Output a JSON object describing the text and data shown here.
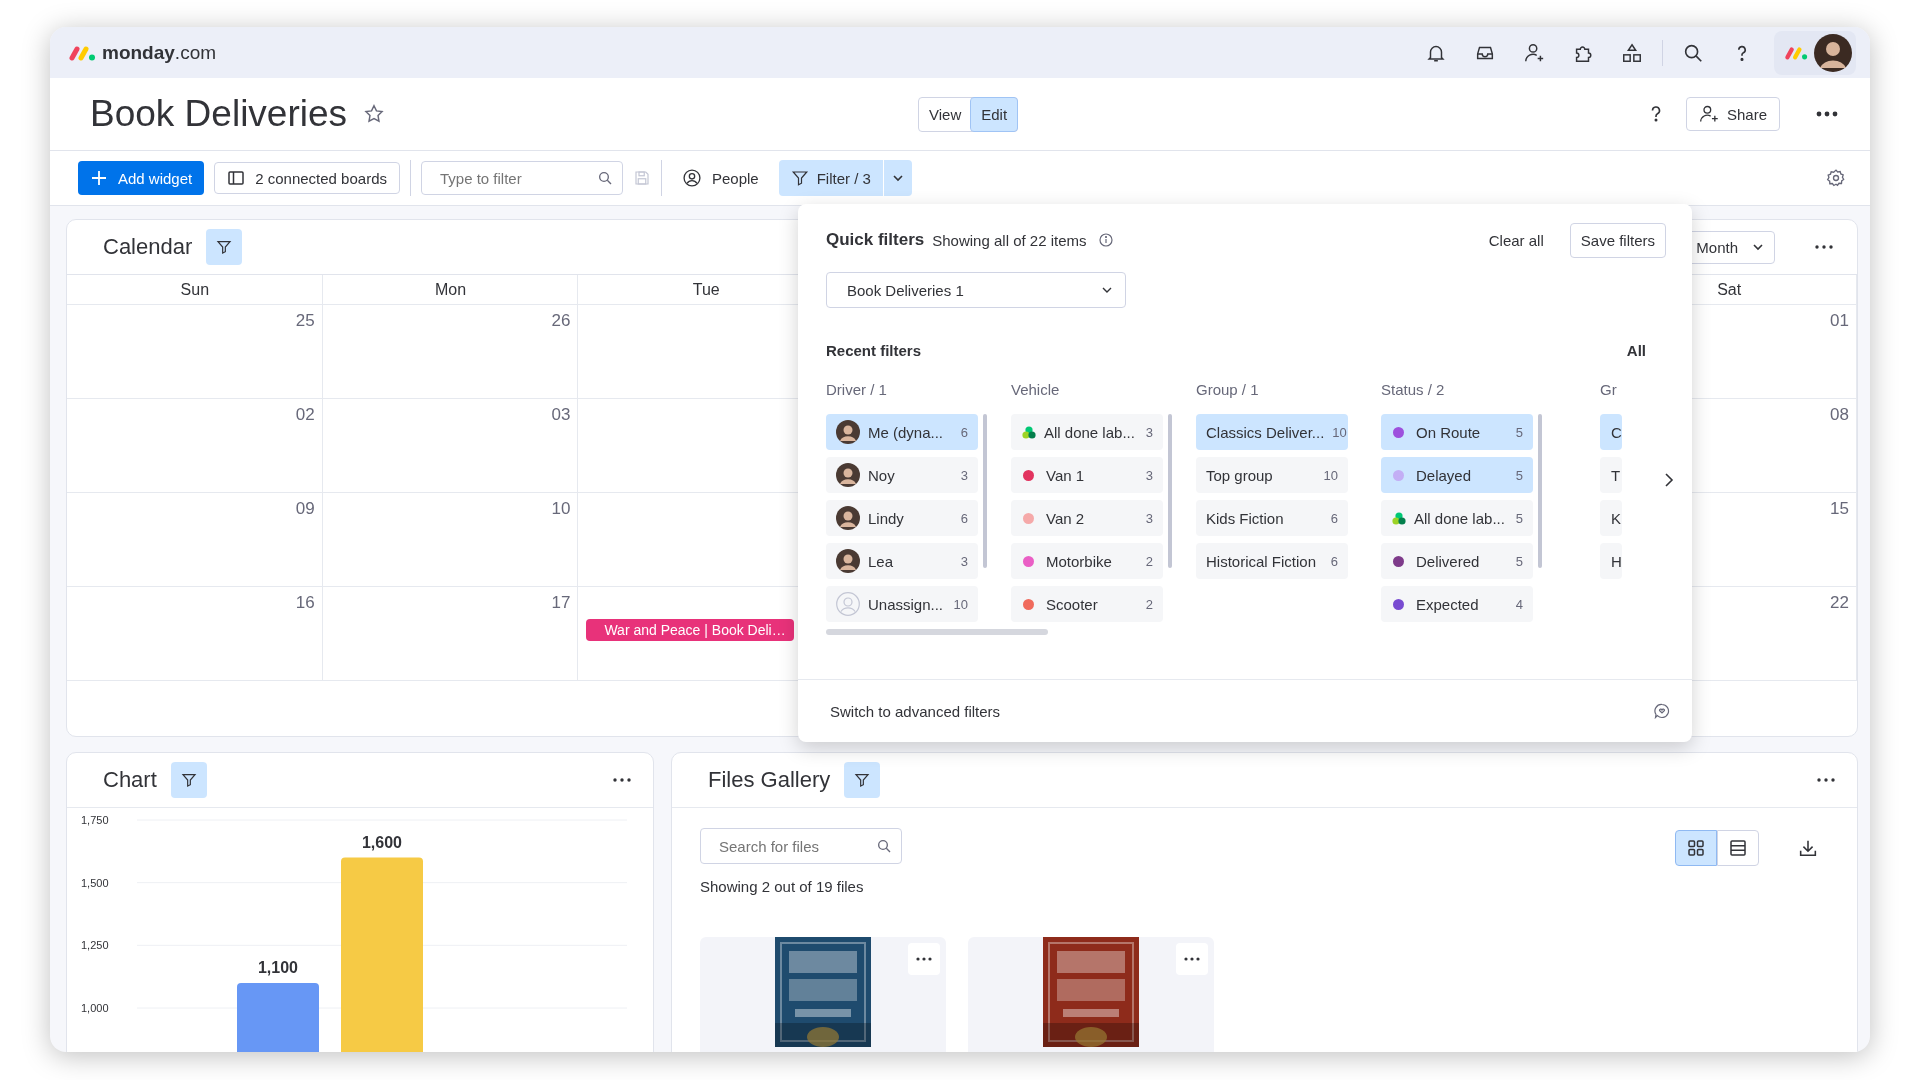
{
  "app": {
    "logo_text": "monday",
    "logo_suffix": ".com"
  },
  "header": {
    "title": "Book Deliveries",
    "starred": false,
    "view_modes": [
      {
        "label": "View",
        "selected": false
      },
      {
        "label": "Edit",
        "selected": true
      }
    ],
    "share": "Share"
  },
  "toolbar": {
    "add_widget": "Add widget",
    "connected_boards": "2 connected boards",
    "filter_placeholder": "Type to filter",
    "people": "People",
    "filter": "Filter / 3",
    "filter_active": true
  },
  "calendar": {
    "title": "Calendar",
    "filter_active": true,
    "view": "Month",
    "days": [
      {
        "label": "Sun",
        "cells": [
          {
            "date": "25"
          },
          {
            "date": "02"
          },
          {
            "date": "09"
          },
          {
            "date": "16"
          }
        ]
      },
      {
        "label": "Mon",
        "cells": [
          {
            "date": "26"
          },
          {
            "date": "03"
          },
          {
            "date": "10"
          },
          {
            "date": "17"
          }
        ]
      },
      {
        "label": "Tue",
        "cells": [
          {},
          {},
          {},
          {
            "event": {
              "title": "War and Peace | Book Deli…",
              "color": "#e8327a"
            }
          }
        ]
      },
      {
        "label": "Sat",
        "cells": [
          {
            "date": "01"
          },
          {
            "date": "08"
          },
          {
            "date": "15"
          },
          {
            "date": "22"
          }
        ]
      }
    ]
  },
  "quick_filters": {
    "title": "Quick filters",
    "summary": "Showing all of 22 items",
    "clear": "Clear all",
    "save": "Save filters",
    "board": "Book Deliveries 1",
    "recent_heading": "Recent filters",
    "all_heading": "All",
    "advanced": "Switch to advanced filters",
    "columns": [
      {
        "kind": "full",
        "heading": "Driver / 1",
        "items": [
          {
            "kind": "avatar",
            "label": "Me (dyna...",
            "count": "6",
            "selected": true
          },
          {
            "kind": "avatar",
            "label": "Noy",
            "count": "3",
            "selected": false
          },
          {
            "kind": "avatar",
            "label": "Lindy",
            "count": "6",
            "selected": false
          },
          {
            "kind": "avatar",
            "label": "Lea",
            "count": "3",
            "selected": false
          },
          {
            "kind": "empty-avatar",
            "label": "Unassign...",
            "count": "10",
            "selected": false
          }
        ]
      },
      {
        "kind": "full",
        "heading": "Vehicle",
        "items": [
          {
            "kind": "cluster",
            "label": "All done lab...",
            "count": "3",
            "selected": false
          },
          {
            "kind": "dot",
            "color": "#e2345f",
            "label": "Van 1",
            "count": "3",
            "selected": false
          },
          {
            "kind": "dot",
            "color": "#f5a9a9",
            "label": "Van 2",
            "count": "3",
            "selected": false
          },
          {
            "kind": "dot",
            "color": "#ea5fc5",
            "label": "Motorbike",
            "count": "2",
            "selected": false
          },
          {
            "kind": "dot",
            "color": "#f06a5c",
            "label": "Scooter",
            "count": "2",
            "selected": false
          }
        ]
      },
      {
        "kind": "full",
        "heading": "Group / 1",
        "items": [
          {
            "kind": "plain",
            "label": "Classics Deliver...",
            "count": "10",
            "selected": true
          },
          {
            "kind": "plain",
            "label": "Top group",
            "count": "10",
            "selected": false
          },
          {
            "kind": "plain",
            "label": "Kids Fiction",
            "count": "6",
            "selected": false
          },
          {
            "kind": "plain",
            "label": "Historical Fiction",
            "count": "6",
            "selected": false
          }
        ]
      },
      {
        "kind": "full",
        "heading": "Status / 2",
        "items": [
          {
            "kind": "dot",
            "color": "#9d50dd",
            "label": "On Route",
            "count": "5",
            "selected": true
          },
          {
            "kind": "dot",
            "color": "#c3aef5",
            "label": "Delayed",
            "count": "5",
            "selected": true
          },
          {
            "kind": "cluster",
            "label": "All done lab...",
            "count": "5",
            "selected": false
          },
          {
            "kind": "dot",
            "color": "#7e3b8a",
            "label": "Delivered",
            "count": "5",
            "selected": false
          },
          {
            "kind": "dot",
            "color": "#784bd1",
            "label": "Expected",
            "count": "4",
            "selected": false
          }
        ]
      },
      {
        "kind": "partial",
        "heading": "Gr",
        "items": [
          {
            "label": "C",
            "selected": true
          },
          {
            "label": "T",
            "selected": false
          },
          {
            "label": "K",
            "selected": false
          },
          {
            "label": "H",
            "selected": false
          }
        ]
      }
    ]
  },
  "chart": {
    "title": "Chart",
    "filter_active": true,
    "chart_data": {
      "type": "bar",
      "grid": true,
      "ylim": [
        1000,
        1750
      ],
      "yticks": [
        {
          "value": 1000,
          "label": "1,000"
        },
        {
          "value": 1250,
          "label": "1,250"
        },
        {
          "value": 1500,
          "label": "1,500"
        },
        {
          "value": 1750,
          "label": "1,750"
        }
      ],
      "values": [
        1100,
        1600
      ],
      "value_labels": [
        "1,100",
        "1,600"
      ],
      "colors": [
        "#6797f5",
        "#f6ca45"
      ]
    }
  },
  "gallery": {
    "title": "Files Gallery",
    "filter_active": true,
    "search_placeholder": "Search for files",
    "summary": "Showing 2 out of 19 files",
    "views": [
      {
        "kind": "grid",
        "selected": true
      },
      {
        "kind": "list",
        "selected": false
      }
    ]
  }
}
